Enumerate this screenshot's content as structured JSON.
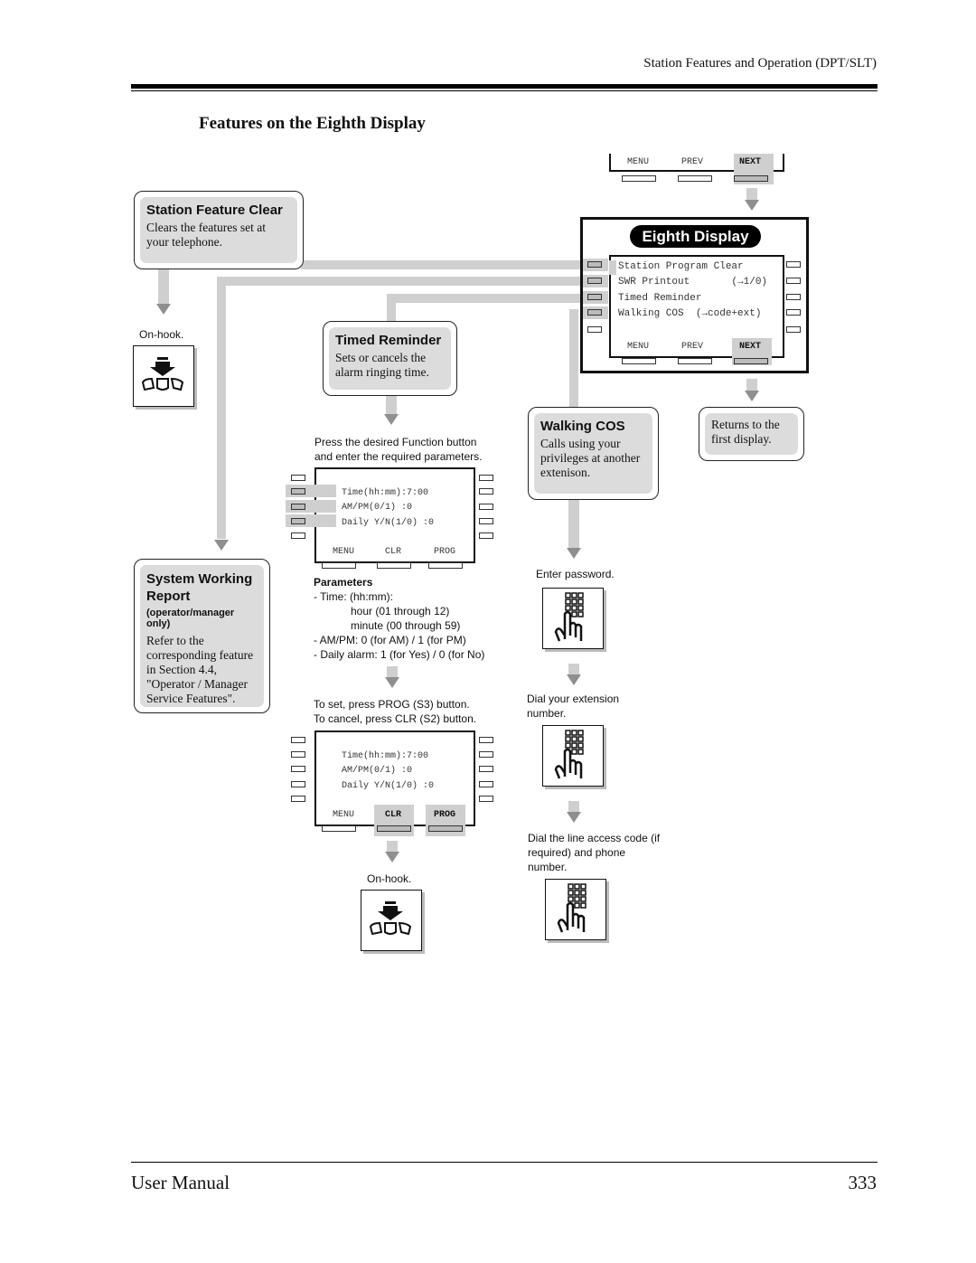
{
  "header": {
    "section": "Station Features and Operation (DPT/SLT)",
    "page_title": "Features on the Eighth Display"
  },
  "footer": {
    "left": "User Manual",
    "page_number": "333"
  },
  "top_softkeys": {
    "menu": "MENU",
    "prev": "PREV",
    "next": "NEXT"
  },
  "eighth_display": {
    "badge": "Eighth Display",
    "lines": [
      "Station Program Clear",
      "SWR Printout       (→1/0)",
      "Timed Reminder",
      "Walking COS  (→code+ext)"
    ],
    "softkeys": {
      "menu": "MENU",
      "prev": "PREV",
      "next": "NEXT"
    }
  },
  "features": {
    "station_feature_clear": {
      "title": "Station Feature Clear",
      "desc": "Clears the features set at your telephone."
    },
    "timed_reminder": {
      "title": "Timed Reminder",
      "desc": "Sets or cancels the alarm ringing time."
    },
    "walking_cos": {
      "title": "Walking COS",
      "desc": "Calls using your privileges at another extenison."
    },
    "system_working_report": {
      "title": "System Working Report",
      "note": "(operator/manager only)",
      "desc": "Refer to the corresponding feature in Section 4.4, \"Operator / Manager Service Features\"."
    },
    "returns": {
      "desc": "Returns to the first display."
    }
  },
  "captions": {
    "on_hook_1": "On-hook.",
    "press_function": "Press the desired Function button and enter the required parameters.",
    "to_set": "To set, press PROG (S3) button.",
    "to_cancel": "To cancel, press CLR (S2) button.",
    "on_hook_2": "On-hook.",
    "enter_password": "Enter password.",
    "dial_extension": "Dial your extension number.",
    "dial_line": "Dial the line access code (if required) and phone number."
  },
  "timed_display": {
    "lines": [
      "Time(hh:mm):7:00",
      "AM/PM(0/1) :0",
      "Daily Y/N(1/0) :0"
    ],
    "softkeys": {
      "menu": "MENU",
      "clr": "CLR",
      "prog": "PROG"
    }
  },
  "parameters": {
    "heading": "Parameters",
    "items": [
      "- Time: (hh:mm):",
      "hour (01 through 12)",
      "minute (00 through 59)",
      "- AM/PM: 0 (for AM) / 1 (for PM)",
      "- Daily alarm: 1 (for Yes) / 0 (for No)"
    ]
  }
}
